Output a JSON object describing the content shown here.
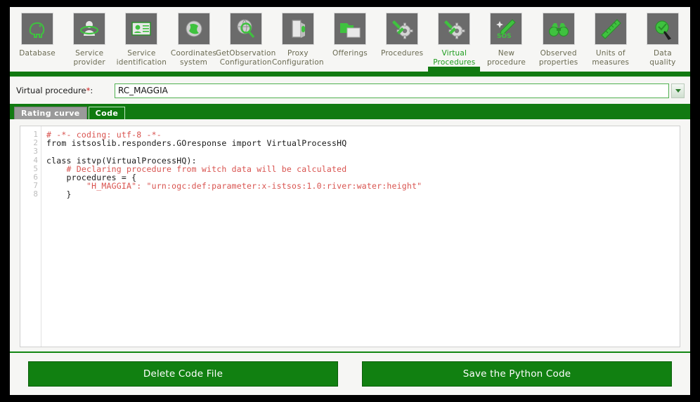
{
  "toolbar": {
    "items": [
      {
        "label": "Database",
        "icon": "database-elephant-icon",
        "active": false
      },
      {
        "label": "Service\nprovider",
        "icon": "service-provider-icon",
        "active": false
      },
      {
        "label": "Service\nidentification",
        "icon": "service-identification-icon",
        "active": false
      },
      {
        "label": "Coordinates\nsystem",
        "icon": "coordinates-globe-icon",
        "active": false
      },
      {
        "label": "GetObservation\nConfiguration",
        "icon": "getobservation-search-icon",
        "active": false
      },
      {
        "label": "Proxy\nConfiguration",
        "icon": "proxy-door-icon",
        "active": false
      },
      {
        "label": "Offerings",
        "icon": "offerings-folder-icon",
        "active": false
      },
      {
        "label": "Procedures",
        "icon": "procedures-gear-icon",
        "active": false
      },
      {
        "label": "Virtual\nProcedures",
        "icon": "virtual-procedures-gear-icon",
        "active": true
      },
      {
        "label": "New\nprocedure",
        "icon": "new-procedure-sos-icon",
        "active": false
      },
      {
        "label": "Observed\nproperties",
        "icon": "observed-binoculars-icon",
        "active": false
      },
      {
        "label": "Units of\nmeasures",
        "icon": "units-ruler-icon",
        "active": false
      },
      {
        "label": "Data\nquality",
        "icon": "data-quality-icon",
        "active": false
      }
    ]
  },
  "form": {
    "label": "Virtual procedure",
    "required_mark": "*",
    "label_colon": ":",
    "value": "RC_MAGGIA",
    "placeholder": "",
    "dropdown_icon": "chevron-down-icon"
  },
  "tabs": [
    {
      "label": "Rating curve",
      "active": false
    },
    {
      "label": "Code",
      "active": true
    }
  ],
  "editor": {
    "line_numbers": [
      "1",
      "2",
      "3",
      "4",
      "5",
      "6",
      "7",
      "8"
    ],
    "lines": [
      {
        "text": "# -*- coding: utf-8 -*-",
        "kind": "comment"
      },
      {
        "text": "from istsoslib.responders.GOresponse import VirtualProcessHQ",
        "kind": "code"
      },
      {
        "text": "",
        "kind": "code"
      },
      {
        "text": "class istvp(VirtualProcessHQ):",
        "kind": "code"
      },
      {
        "text": "    # Declaring procedure from witch data will be calculated",
        "kind": "comment"
      },
      {
        "text": "    procedures = {",
        "kind": "code"
      },
      {
        "text": "        \"H_MAGGIA\": \"urn:ogc:def:parameter:x-istsos:1.0:river:water:height\"",
        "kind": "string"
      },
      {
        "text": "    }",
        "kind": "code"
      }
    ]
  },
  "footer": {
    "delete_label": "Delete Code File",
    "save_label": "Save the Python Code"
  },
  "colors": {
    "brand_green": "#117a11",
    "button_green": "#118011",
    "comment_red": "#d9534f",
    "icon_bg": "#6b6b6b",
    "page_bg": "#f6f6f4",
    "label_olive": "#6a6a52"
  }
}
